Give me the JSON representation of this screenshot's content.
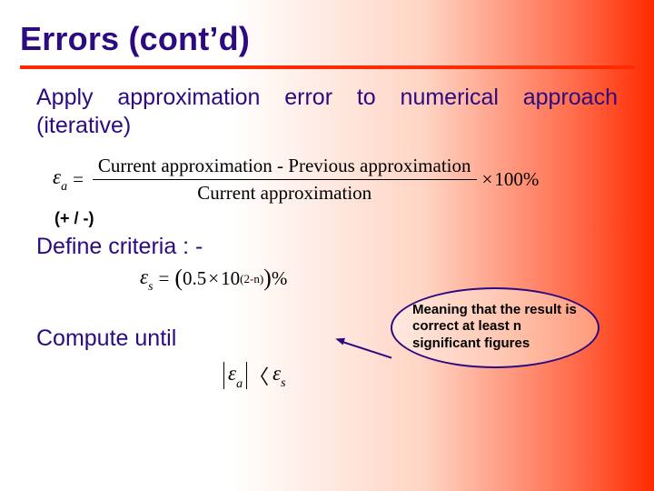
{
  "title": "Errors (cont’d)",
  "intro": "Apply approximation error to numerical approach (iterative)",
  "eq1": {
    "lhs": "ε",
    "lhs_sub": "a",
    "eq": "=",
    "num": "Current approximation - Previous approximation",
    "den": "Current approximation",
    "times": "×",
    "tail": "100%"
  },
  "pm": "(+ / -)",
  "define": "Define criteria : -",
  "eq2": {
    "lhs": "ε",
    "lhs_sub": "s",
    "eq": "=",
    "open": "(",
    "coeff": "0.5",
    "times": "×",
    "base": "10",
    "exp_open": "(2",
    "exp_minus": "-",
    "exp_n": "n)",
    "close": ")",
    "tail": "%"
  },
  "callout": "Meaning that the result is correct at least n significant figures",
  "compute": "Compute until",
  "eq3": {
    "ea": "ε",
    "ea_sub": "a",
    "lt": "〈",
    "es": "ε",
    "es_sub": "s"
  }
}
